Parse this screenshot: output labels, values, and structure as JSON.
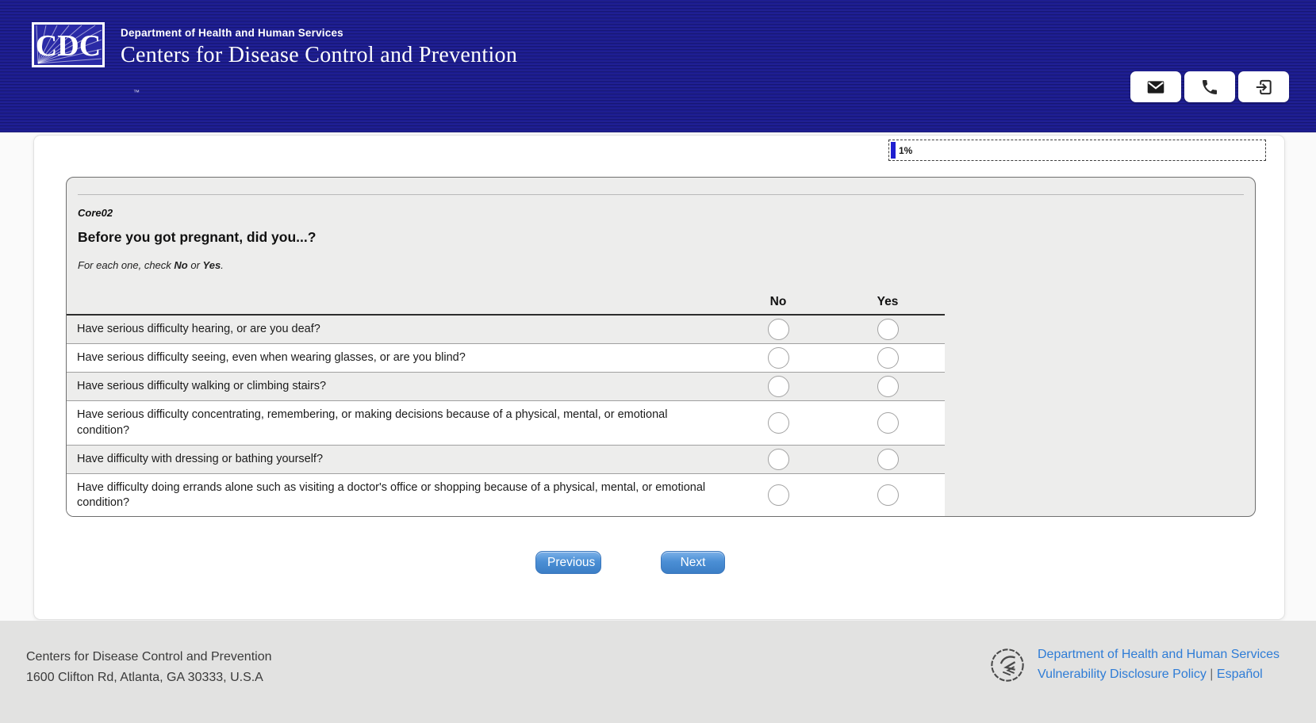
{
  "header": {
    "logo_text": "CDC",
    "trademark": "™",
    "agency_small": "Department of Health and Human Services",
    "agency_large": "Centers for Disease Control and Prevention"
  },
  "toolbar": {
    "buttons": [
      {
        "icon": "mail-icon"
      },
      {
        "icon": "phone-icon"
      },
      {
        "icon": "exit-icon"
      }
    ]
  },
  "progress": {
    "label": "1%",
    "percent": 1
  },
  "survey": {
    "question_id": "Core02",
    "question": "Before you got pregnant, did you...?",
    "instruction": {
      "prefix": "For each one, check ",
      "no": "No",
      "or": " or ",
      "yes": "Yes",
      "period": "."
    },
    "columns": [
      "No",
      "Yes"
    ],
    "rows": [
      "Have serious difficulty hearing, or are you deaf?",
      "Have serious difficulty seeing, even when wearing glasses, or are you blind?",
      "Have serious difficulty walking or climbing stairs?",
      "Have serious difficulty concentrating, remembering, or making decisions because of a physical, mental, or emotional condition?",
      "Have difficulty with dressing or bathing yourself?",
      "Have difficulty doing errands alone such as visiting a doctor's office or shopping because of a physical, mental, or emotional condition?"
    ]
  },
  "nav": {
    "previous": "Previous",
    "next": "Next"
  },
  "footer": {
    "address_line1": "Centers for Disease Control and Prevention",
    "address_line2": "1600 Clifton Rd, Atlanta, GA 30333, U.S.A",
    "link_hhs": "Department of Health and Human Services",
    "link_vdp": "Vulnerability Disclosure Policy",
    "separator": "|",
    "link_espanol": "Español"
  },
  "colors": {
    "header_navy": "#1c1c90",
    "progress_blue": "#1f1fd0",
    "button_blue": "#4b8fd5",
    "link_blue": "#2e7cd6",
    "card_gray": "#ededec",
    "footer_gray": "#e2e2e1"
  }
}
